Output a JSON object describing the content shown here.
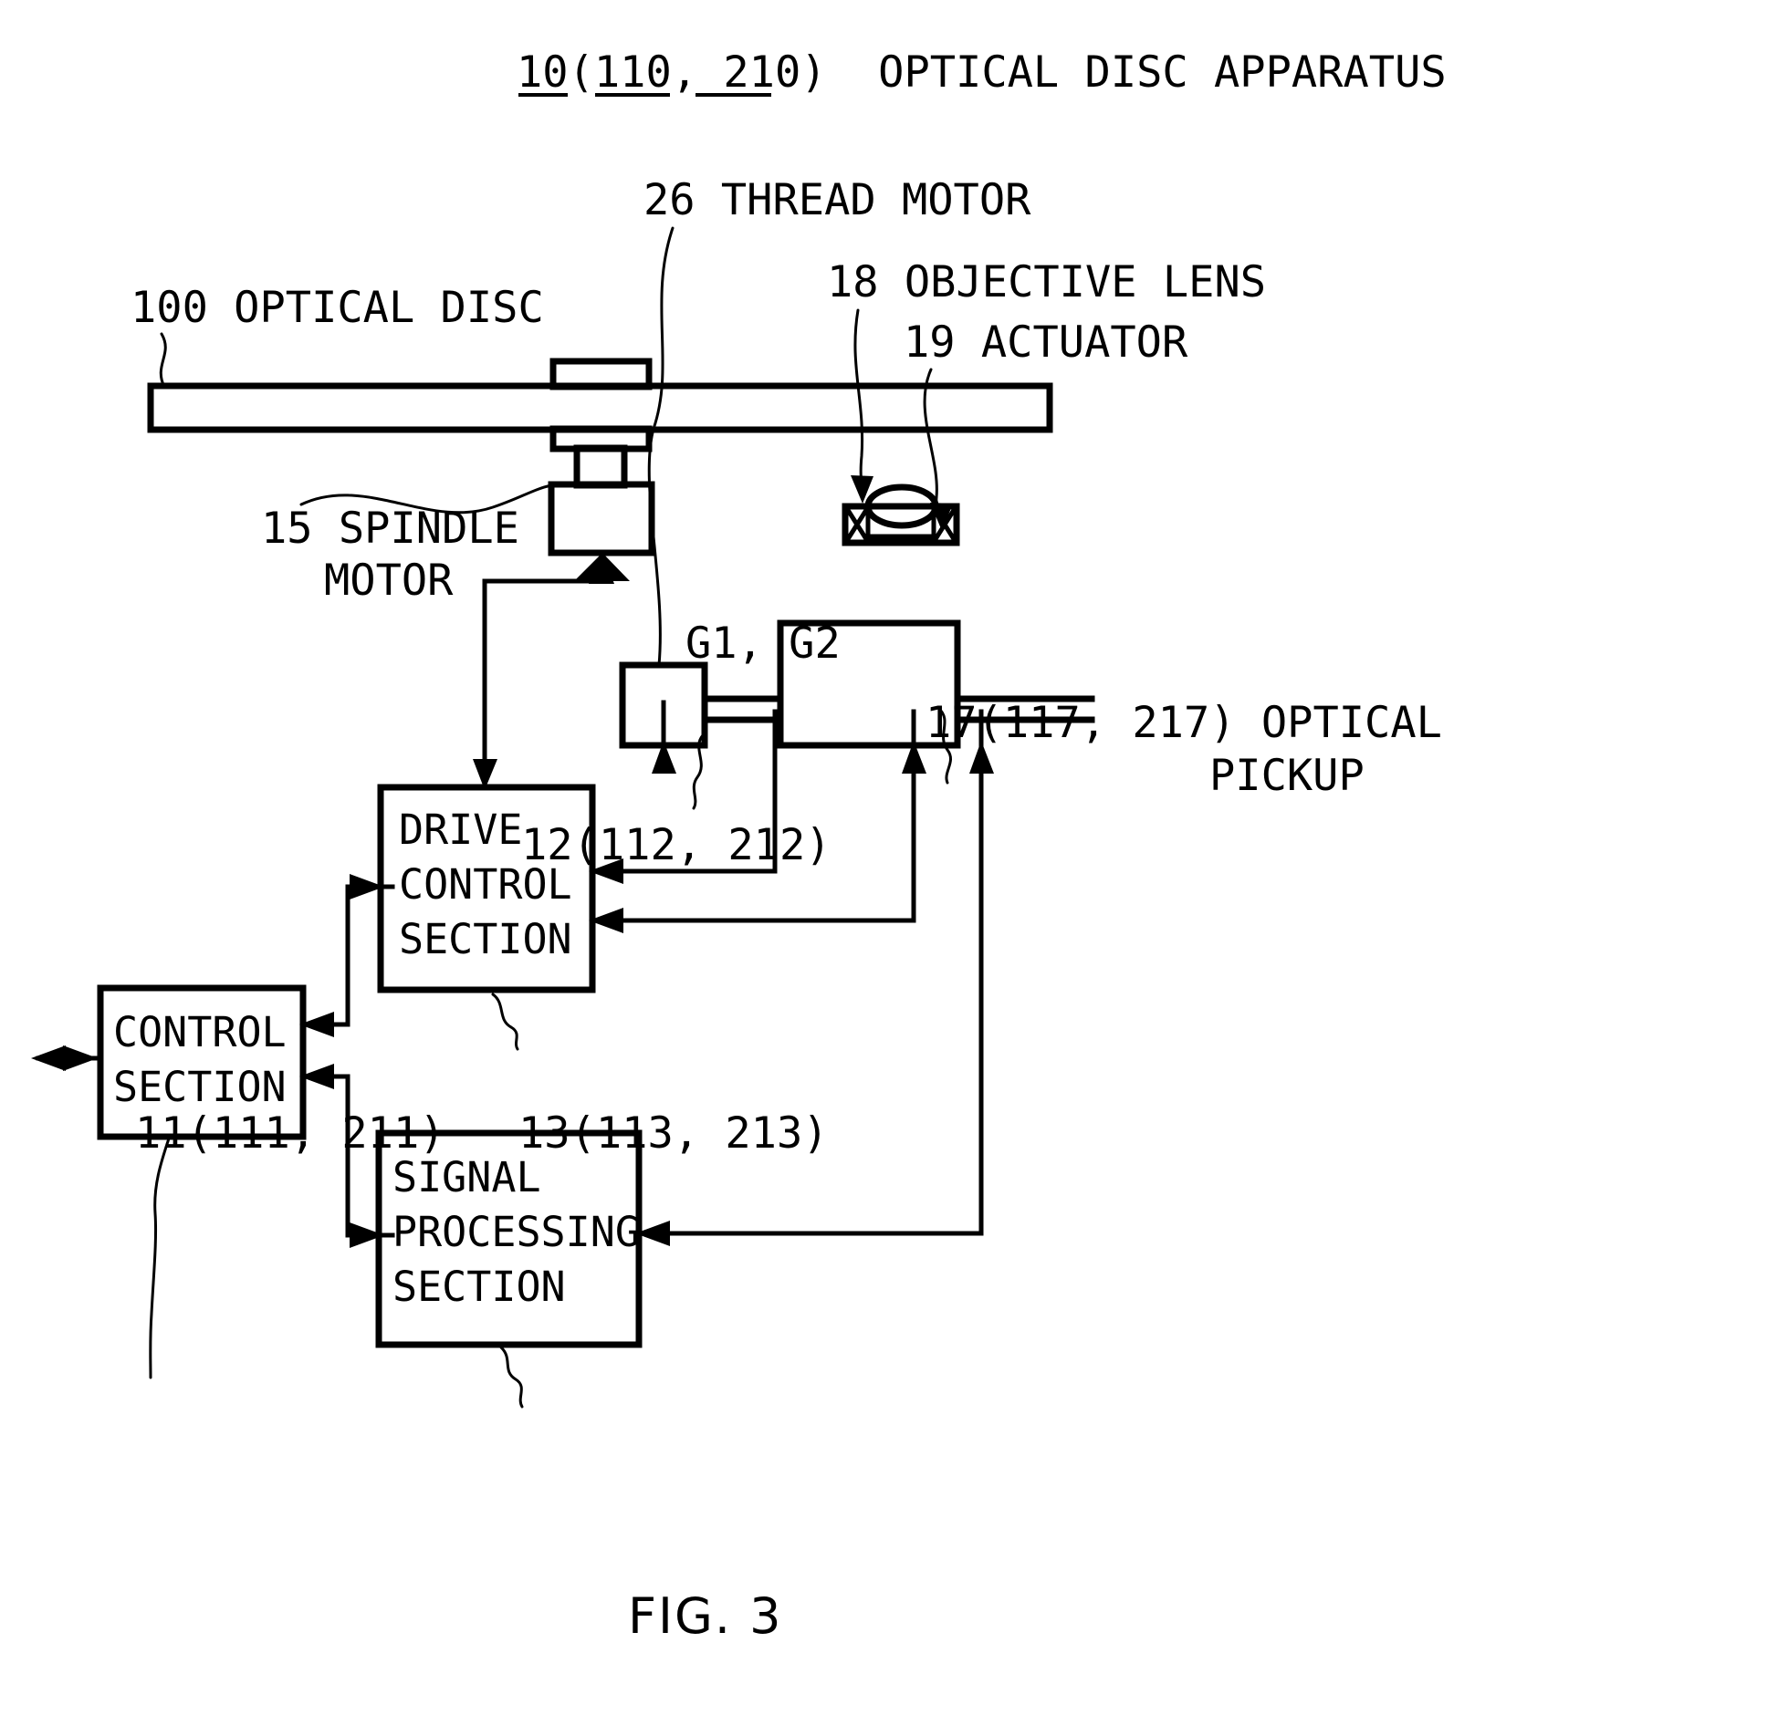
{
  "figure": {
    "caption": "FIG. 3",
    "title_number": "10",
    "title_paren": "(110, 210)",
    "title_text": "OPTICAL DISC APPARATUS",
    "title_full": "10(110, 210)  OPTICAL DISC APPARATUS"
  },
  "callouts": {
    "optical_disc": "100 OPTICAL DISC",
    "thread_motor": "26 THREAD MOTOR",
    "objective_lens": "18 OBJECTIVE LENS",
    "actuator": "19 ACTUATOR",
    "spindle_motor_line1": "15 SPINDLE",
    "spindle_motor_line2": "MOTOR",
    "gears": "G1, G2",
    "optical_pickup_line1": "17(117, 217) OPTICAL",
    "optical_pickup_line2": "PICKUP",
    "drive_control_ref": "12(112, 212)",
    "control_section_ref": "11(111, 211)",
    "signal_processing_ref": "13(113, 213)"
  },
  "blocks": {
    "drive_control": {
      "line1": "DRIVE",
      "line2": "CONTROL",
      "line3": "SECTION"
    },
    "control_section": {
      "line1": "CONTROL",
      "line2": "SECTION"
    },
    "signal_processing": {
      "line1": "SIGNAL",
      "line2": "PROCESSING",
      "line3": "SECTION"
    }
  },
  "colors": {
    "ink": "#000000",
    "paper": "#ffffff"
  }
}
